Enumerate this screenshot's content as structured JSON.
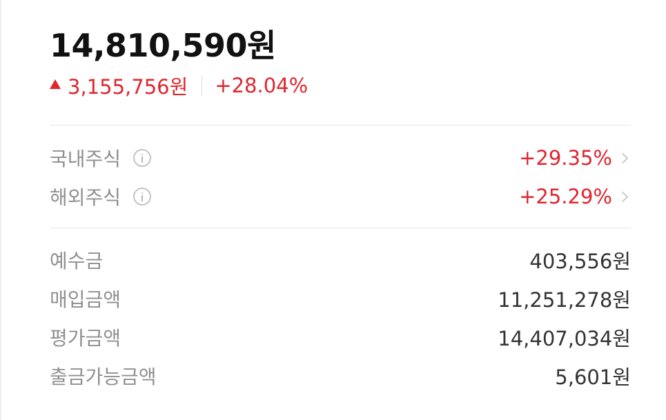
{
  "summary": {
    "total_value": "14,810,590원",
    "change_amount": "3,155,756원",
    "change_percent": "+28.04%"
  },
  "returns": [
    {
      "label": "국내주식",
      "percent": "+29.35%"
    },
    {
      "label": "해외주식",
      "percent": "+25.29%"
    }
  ],
  "details": [
    {
      "label": "예수금",
      "value": "403,556원"
    },
    {
      "label": "매입금액",
      "value": "11,251,278원"
    },
    {
      "label": "평가금액",
      "value": "14,407,034원"
    },
    {
      "label": "출금가능금액",
      "value": "5,601원"
    }
  ],
  "colors": {
    "positive": "#e0252e",
    "label": "#8f8f8f",
    "value": "#333333"
  },
  "icons": {
    "up": "up-triangle-icon",
    "info": "info-icon",
    "more": "chevron-right-icon"
  }
}
